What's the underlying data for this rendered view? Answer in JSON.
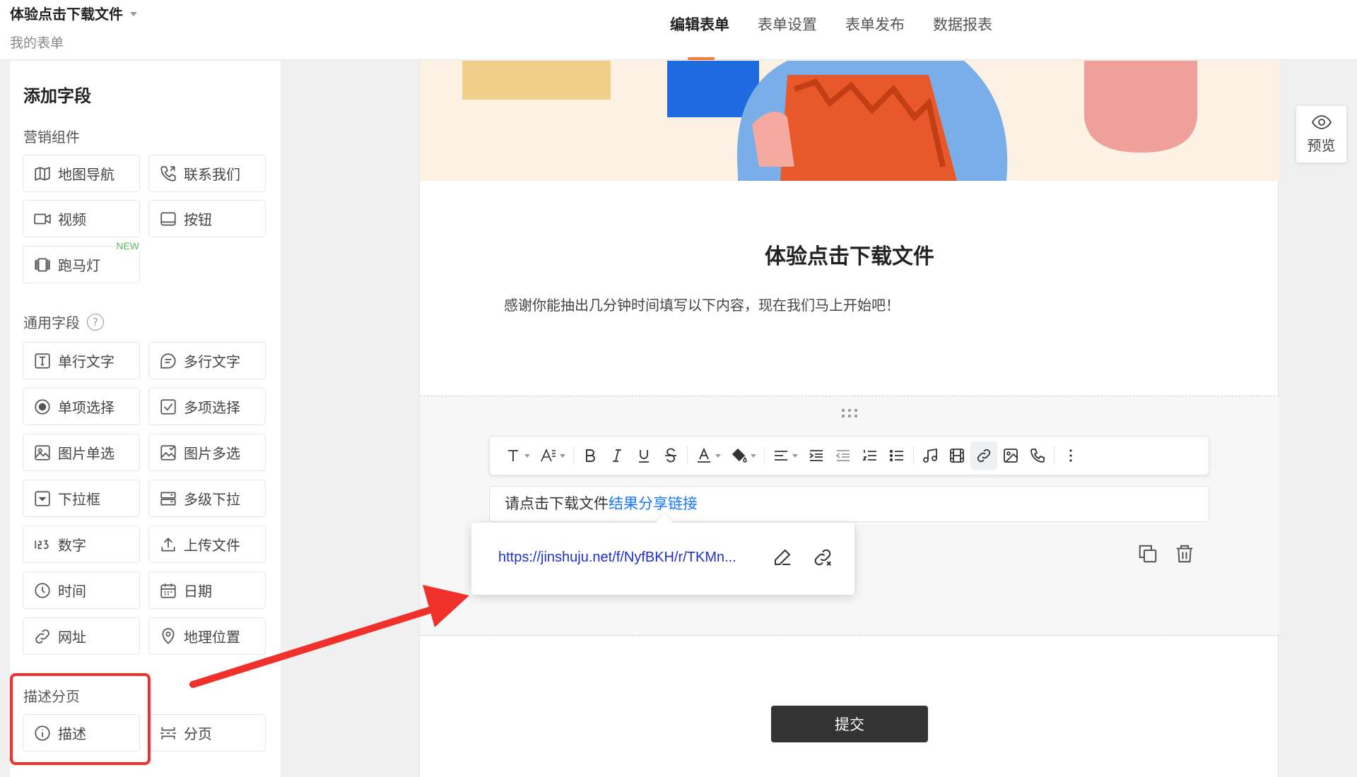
{
  "header": {
    "form_title": "体验点击下载文件",
    "breadcrumb": "我的表单",
    "tabs": [
      "编辑表单",
      "表单设置",
      "表单发布",
      "数据报表"
    ],
    "active_tab": "编辑表单"
  },
  "sidebar": {
    "title": "添加字段",
    "sections": {
      "marketing": {
        "title": "营销组件",
        "items": [
          {
            "label": "地图导航",
            "icon": "map-icon"
          },
          {
            "label": "联系我们",
            "icon": "phone-icon"
          },
          {
            "label": "视频",
            "icon": "video-icon"
          },
          {
            "label": "按钮",
            "icon": "button-icon"
          },
          {
            "label": "跑马灯",
            "icon": "carousel-icon",
            "badge": "NEW"
          }
        ]
      },
      "general": {
        "title": "通用字段",
        "help": "?",
        "items": [
          {
            "label": "单行文字",
            "icon": "text-field-icon"
          },
          {
            "label": "多行文字",
            "icon": "textarea-icon"
          },
          {
            "label": "单项选择",
            "icon": "radio-icon"
          },
          {
            "label": "多项选择",
            "icon": "checkbox-icon"
          },
          {
            "label": "图片单选",
            "icon": "image-radio-icon"
          },
          {
            "label": "图片多选",
            "icon": "image-checkbox-icon"
          },
          {
            "label": "下拉框",
            "icon": "dropdown-icon"
          },
          {
            "label": "多级下拉",
            "icon": "cascade-icon"
          },
          {
            "label": "数字",
            "icon": "number-icon"
          },
          {
            "label": "上传文件",
            "icon": "upload-icon"
          },
          {
            "label": "时间",
            "icon": "clock-icon"
          },
          {
            "label": "日期",
            "icon": "calendar-icon"
          },
          {
            "label": "网址",
            "icon": "link-icon"
          },
          {
            "label": "地理位置",
            "icon": "location-icon"
          }
        ]
      },
      "description": {
        "title": "描述分页",
        "items": [
          {
            "label": "描述",
            "icon": "info-icon"
          },
          {
            "label": "分页",
            "icon": "page-break-icon"
          }
        ]
      }
    }
  },
  "form": {
    "heading": "体验点击下载文件",
    "intro": "感谢你能抽出几分钟时间填写以下内容，现在我们马上开始吧！",
    "editor": {
      "text_before": "请点击下载文件",
      "link_text": "结果分享链接",
      "popup_url": "https://jinshuju.net/f/NyfBKH/r/TKMn..."
    },
    "submit_label": "提交"
  },
  "preview": {
    "label": "预览"
  },
  "colors": {
    "accent": "#ff7a30",
    "highlight_box": "#f0302a",
    "link": "#1677ff",
    "submit_bg": "#333333",
    "banner_bg": "#fdf1e3"
  }
}
